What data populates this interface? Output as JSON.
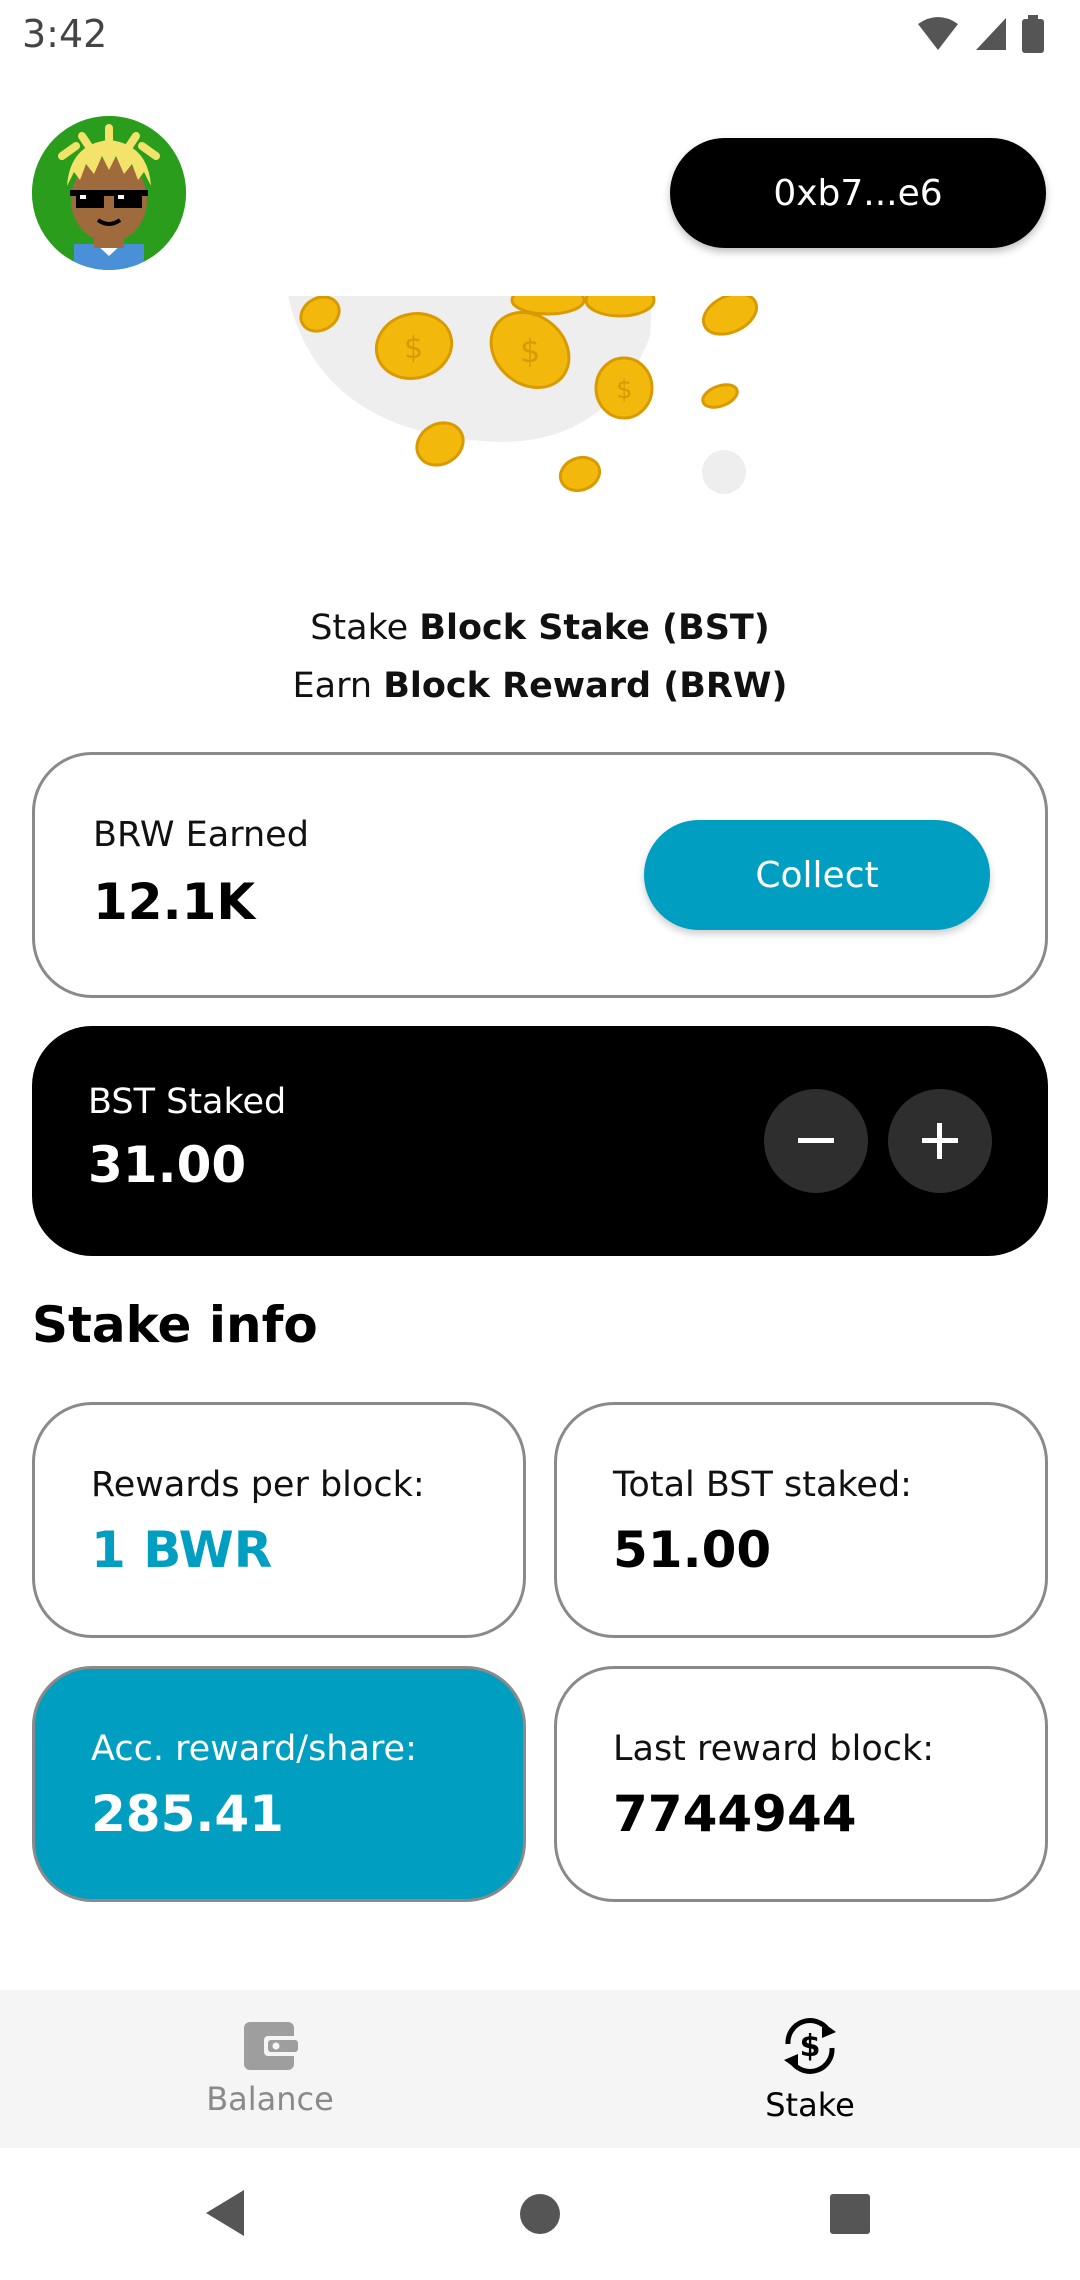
{
  "status_bar": {
    "time": "3:42"
  },
  "header": {
    "wallet_address": "0xb7...e6"
  },
  "intro": {
    "stake_prefix": "Stake",
    "stake_token": "Block Stake (BST)",
    "earn_prefix": "Earn",
    "earn_token": "Block Reward (BRW)"
  },
  "earned": {
    "label": "BRW Earned",
    "value": "12.1K",
    "collect_label": "Collect"
  },
  "staked": {
    "label": "BST Staked",
    "value": "31.00"
  },
  "stake_info": {
    "title": "Stake info",
    "cards": [
      {
        "label": "Rewards per block:",
        "value": "1 BWR"
      },
      {
        "label": "Total BST staked:",
        "value": "51.00"
      },
      {
        "label": "Acc. reward/share:",
        "value": "285.41"
      },
      {
        "label": "Last reward block:",
        "value": "7744944"
      }
    ]
  },
  "nav": {
    "items": [
      {
        "label": "Balance",
        "icon": "wallet-icon",
        "active": false
      },
      {
        "label": "Stake",
        "icon": "stake-icon",
        "active": true
      }
    ]
  },
  "colors": {
    "accent": "#009ec0",
    "dark": "#000000",
    "card_border": "#8a8a8a"
  }
}
